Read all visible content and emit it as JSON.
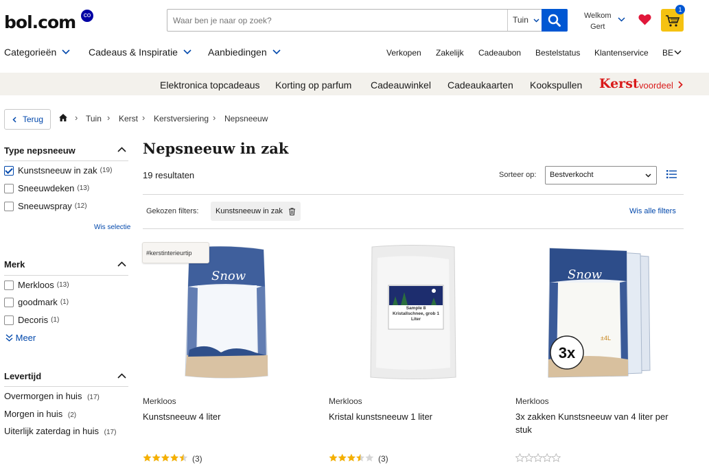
{
  "colors": {
    "brand": "#0000a4",
    "accent": "#0057d3",
    "link": "#0047ab",
    "cart": "#f5c211",
    "kerst": "#d91a1a",
    "star": "#f5b000"
  },
  "header": {
    "logo": "bol.com",
    "logo_badge": "co",
    "search": {
      "placeholder": "Waar ben je naar op zoek?",
      "category": "Tuin"
    },
    "welcome_label": "Welkom",
    "user_name": "Gert",
    "cart_count": "1"
  },
  "main_nav": [
    {
      "label": "Categorieën"
    },
    {
      "label": "Cadeaus & Inspiratie"
    },
    {
      "label": "Aanbiedingen"
    }
  ],
  "top_links": [
    "Verkopen",
    "Zakelijk",
    "Cadeaubon",
    "Bestelstatus",
    "Klantenservice",
    "BE"
  ],
  "promo_links": [
    "Elektronica topcadeaus",
    "Korting op parfum",
    "Cadeauwinkel",
    "Cadeaukaarten",
    "Kookspullen"
  ],
  "promo_kerst": {
    "word": "Kerst",
    "suffix": "voordeel"
  },
  "breadcrumb": {
    "back": "Terug",
    "items": [
      "Tuin",
      "Kerst",
      "Kerstversiering",
      "Nepsneeuw"
    ]
  },
  "sidebar": {
    "type": {
      "title": "Type nepsneeuw",
      "options": [
        {
          "label": "Kunstsneeuw in zak",
          "count": "(19)",
          "checked": true
        },
        {
          "label": "Sneeuwdeken",
          "count": "(13)",
          "checked": false
        },
        {
          "label": "Sneeuwspray",
          "count": "(12)",
          "checked": false
        }
      ],
      "clear": "Wis selectie"
    },
    "merk": {
      "title": "Merk",
      "options": [
        {
          "label": "Merkloos",
          "count": "(13)",
          "checked": false
        },
        {
          "label": "goodmark",
          "count": "(1)",
          "checked": false
        },
        {
          "label": "Decoris",
          "count": "(1)",
          "checked": false
        }
      ],
      "more": "Meer"
    },
    "levertijd": {
      "title": "Levertijd",
      "options": [
        {
          "label": "Overmorgen in huis",
          "count": "(17)"
        },
        {
          "label": "Morgen in huis",
          "count": "(2)"
        },
        {
          "label": "Uiterlijk zaterdag in huis",
          "count": "(17)"
        }
      ]
    }
  },
  "main": {
    "title": "Nepsneeuw in zak",
    "results": "19 resultaten",
    "sort_label": "Sorteer op:",
    "sort_value": "Bestverkocht",
    "filters_label": "Gekozen filters:",
    "active_filter": "Kunstsneeuw in zak",
    "clear_all": "Wis alle filters"
  },
  "products": [
    {
      "tag": "#kerstinterieurtip",
      "brand": "Merkloos",
      "title": "Kunstsneeuw 4 liter",
      "rating": 4.5,
      "reviews": "(3)",
      "bag_text": "Snow"
    },
    {
      "brand": "Merkloos",
      "title": "Kristal kunstsneeuw 1 liter",
      "rating": 3.5,
      "reviews": "(3)",
      "label_text": "Sample 8 Kristallschnee, grob 1 Liter"
    },
    {
      "brand": "Merkloos",
      "title": "3x zakken Kunstsneeuw van 4 liter per stuk",
      "rating": 0,
      "reviews": "",
      "bag_text": "Snow",
      "badge": "3x",
      "bag_size": "±4L"
    }
  ]
}
